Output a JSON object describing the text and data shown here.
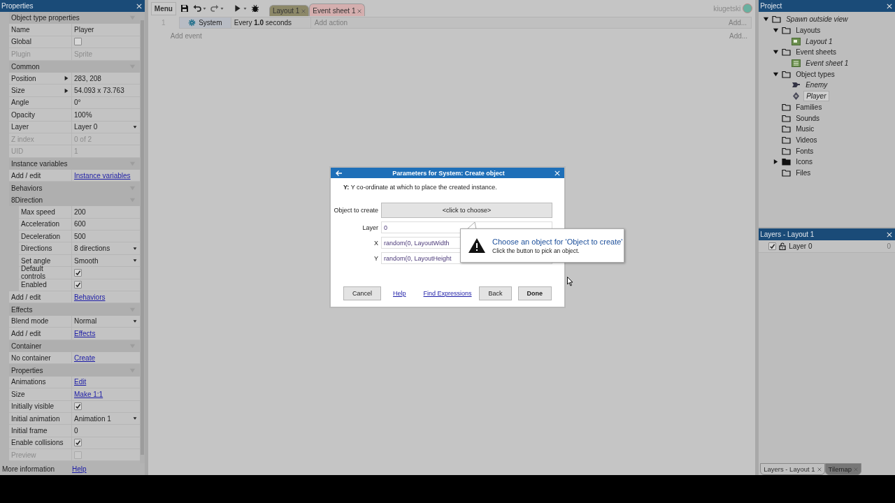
{
  "properties": {
    "title": "Properties",
    "sections": [
      {
        "title": "Object type properties",
        "rows": [
          {
            "label": "Name",
            "kind": "text",
            "value": "Player",
            "disabled": false
          },
          {
            "label": "Global",
            "kind": "checkbox",
            "checked": false,
            "disabled": false
          },
          {
            "label": "Plugin",
            "kind": "text",
            "value": "Sprite",
            "disabled": true
          }
        ]
      },
      {
        "title": "Common",
        "rows": [
          {
            "label": "Position",
            "kind": "expand",
            "value": "283, 208",
            "disabled": false
          },
          {
            "label": "Size",
            "kind": "expand",
            "value": "54.093 x 73.763",
            "disabled": false
          },
          {
            "label": "Angle",
            "kind": "text",
            "value": "0°",
            "disabled": false
          },
          {
            "label": "Opacity",
            "kind": "text",
            "value": "100%",
            "disabled": false
          },
          {
            "label": "Layer",
            "kind": "dropdown",
            "value": "Layer 0",
            "disabled": false
          },
          {
            "label": "Z index",
            "kind": "text",
            "value": "0 of 2",
            "disabled": true
          },
          {
            "label": "UID",
            "kind": "text",
            "value": "1",
            "disabled": true
          }
        ]
      },
      {
        "title": "Instance variables",
        "rows": [
          {
            "label": "Add / edit",
            "kind": "link",
            "value": "Instance variables",
            "disabled": false
          }
        ]
      },
      {
        "title": "Behaviors",
        "rows": [
          {
            "label": "8Direction",
            "kind": "group",
            "children": [
              {
                "label": "Max speed",
                "kind": "text",
                "value": "200",
                "disabled": false
              },
              {
                "label": "Acceleration",
                "kind": "text",
                "value": "600",
                "disabled": false
              },
              {
                "label": "Deceleration",
                "kind": "text",
                "value": "500",
                "disabled": false
              },
              {
                "label": "Directions",
                "kind": "dropdown",
                "value": "8 directions",
                "disabled": false
              },
              {
                "label": "Set angle",
                "kind": "dropdown",
                "value": "Smooth",
                "disabled": false
              },
              {
                "label": "Default controls",
                "kind": "checkbox",
                "checked": true,
                "disabled": false
              },
              {
                "label": "Enabled",
                "kind": "checkbox",
                "checked": true,
                "disabled": false
              }
            ]
          },
          {
            "label": "Add / edit",
            "kind": "link",
            "value": "Behaviors",
            "disabled": false
          }
        ]
      },
      {
        "title": "Effects",
        "rows": [
          {
            "label": "Blend mode",
            "kind": "dropdown",
            "value": "Normal",
            "disabled": false
          },
          {
            "label": "Add / edit",
            "kind": "link",
            "value": "Effects",
            "disabled": false
          }
        ]
      },
      {
        "title": "Container",
        "rows": [
          {
            "label": "No container",
            "kind": "link",
            "value": "Create",
            "disabled": false
          }
        ]
      },
      {
        "title": "Properties",
        "rows": [
          {
            "label": "Animations",
            "kind": "link",
            "value": "Edit",
            "disabled": false
          },
          {
            "label": "Size",
            "kind": "link",
            "value": "Make 1:1",
            "disabled": false
          },
          {
            "label": "Initially visible",
            "kind": "checkbox",
            "checked": true,
            "disabled": false
          },
          {
            "label": "Initial animation",
            "kind": "dropdown",
            "value": "Animation 1",
            "disabled": false
          },
          {
            "label": "Initial frame",
            "kind": "text",
            "value": "0",
            "disabled": false
          },
          {
            "label": "Enable collisions",
            "kind": "checkbox",
            "checked": true,
            "disabled": false
          },
          {
            "label": "Preview",
            "kind": "checkbox",
            "checked": false,
            "disabled": true
          }
        ]
      }
    ],
    "footer": {
      "label": "More information",
      "link": "Help"
    }
  },
  "toolbar": {
    "menu": "Menu",
    "tabs": [
      {
        "label": "Layout 1",
        "color": "#8c8868",
        "selected": false
      },
      {
        "label": "Event sheet 1",
        "color": "#d4aeae",
        "selected": true
      }
    ],
    "user": "kiugetski"
  },
  "events": {
    "rows": [
      {
        "number": "1",
        "object": "System",
        "condition": "Every **1.0** seconds",
        "action_placeholder": "Add action",
        "add": "Add..."
      }
    ],
    "add_event": "Add event",
    "add_event_more": "Add..."
  },
  "project": {
    "title": "Project",
    "tree": [
      {
        "label": "Spawn outside view",
        "kind": "folder",
        "expanded": true,
        "selected": false,
        "children": [
          {
            "label": "Layouts",
            "kind": "folder",
            "expanded": true,
            "selected": false,
            "children": [
              {
                "label": "Layout 1",
                "kind": "layout",
                "selected": false
              }
            ]
          },
          {
            "label": "Event sheets",
            "kind": "folder",
            "expanded": true,
            "selected": false,
            "children": [
              {
                "label": "Event sheet 1",
                "kind": "event-sheet",
                "selected": false
              }
            ]
          },
          {
            "label": "Object types",
            "kind": "folder",
            "expanded": true,
            "selected": false,
            "children": [
              {
                "label": "Enemy",
                "kind": "enemy",
                "selected": false
              },
              {
                "label": "Player",
                "kind": "player",
                "selected": true
              }
            ]
          },
          {
            "label": "Families",
            "kind": "folder",
            "selected": false
          },
          {
            "label": "Sounds",
            "kind": "folder",
            "selected": false
          },
          {
            "label": "Music",
            "kind": "folder",
            "selected": false
          },
          {
            "label": "Videos",
            "kind": "folder",
            "selected": false
          },
          {
            "label": "Fonts",
            "kind": "folder",
            "selected": false
          },
          {
            "label": "Icons",
            "kind": "folder",
            "expanded": false,
            "selected": false
          },
          {
            "label": "Files",
            "kind": "folder",
            "selected": false
          }
        ]
      }
    ]
  },
  "layers": {
    "title": "Layers - Layout 1",
    "rows": [
      {
        "name": "Layer 0",
        "visible": true,
        "locked": false,
        "count": "0"
      }
    ],
    "tabs": [
      {
        "label": "Layers - Layout 1",
        "selected": true
      },
      {
        "label": "Tilemap",
        "selected": false
      }
    ]
  },
  "dialog": {
    "title": "Parameters for System: Create object",
    "description": "**Y:** Y co-ordinate at which to place the created instance.",
    "params": [
      {
        "label": "Object to create",
        "kind": "button",
        "value": "<click to choose>"
      },
      {
        "label": "Layer",
        "kind": "field",
        "value": "0"
      },
      {
        "label": "X",
        "kind": "field",
        "value": "random(0, LayoutWidth"
      },
      {
        "label": "Y",
        "kind": "field",
        "value": "random(0, LayoutHeight"
      }
    ],
    "buttons": {
      "cancel": "Cancel",
      "help": "Help",
      "find": "Find Expressions",
      "back": "Back",
      "done": "Done"
    },
    "tooltip": {
      "title": "Choose an object for 'Object to create'",
      "text": "Click the button to pick an object."
    }
  }
}
